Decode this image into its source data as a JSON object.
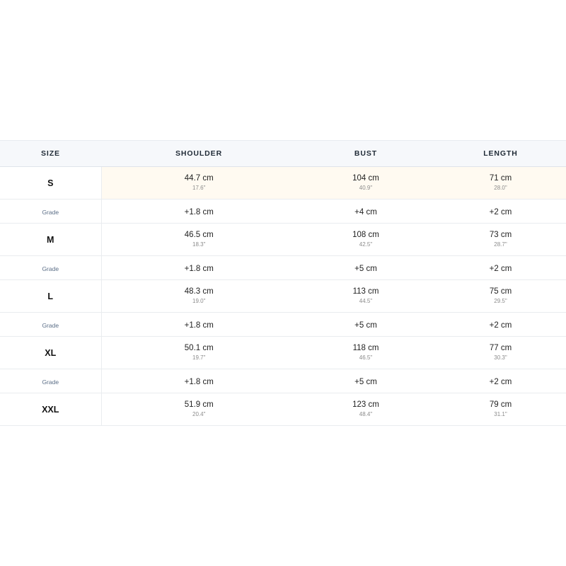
{
  "header": {
    "size": "SIZE",
    "shoulder": "SHOULDER",
    "bust": "BUST",
    "length": "LENGTH"
  },
  "grade_label": "Grade",
  "sizes": [
    {
      "name": "S",
      "shoulder": {
        "cm": "44.7 cm",
        "in": "17.6\""
      },
      "bust": {
        "cm": "104 cm",
        "in": "40.9\""
      },
      "length": {
        "cm": "71 cm",
        "in": "28.0\""
      }
    },
    {
      "name": "M",
      "shoulder": {
        "cm": "46.5 cm",
        "in": "18.3\""
      },
      "bust": {
        "cm": "108 cm",
        "in": "42.5\""
      },
      "length": {
        "cm": "73 cm",
        "in": "28.7\""
      }
    },
    {
      "name": "L",
      "shoulder": {
        "cm": "48.3 cm",
        "in": "19.0\""
      },
      "bust": {
        "cm": "113 cm",
        "in": "44.5\""
      },
      "length": {
        "cm": "75 cm",
        "in": "29.5\""
      }
    },
    {
      "name": "XL",
      "shoulder": {
        "cm": "50.1 cm",
        "in": "19.7\""
      },
      "bust": {
        "cm": "118 cm",
        "in": "46.5\""
      },
      "length": {
        "cm": "77 cm",
        "in": "30.3\""
      }
    },
    {
      "name": "XXL",
      "shoulder": {
        "cm": "51.9 cm",
        "in": "20.4\""
      },
      "bust": {
        "cm": "123 cm",
        "in": "48.4\""
      },
      "length": {
        "cm": "79 cm",
        "in": "31.1\""
      }
    }
  ],
  "grades": [
    {
      "shoulder": "+1.8 cm",
      "bust": "+4 cm",
      "length": "+2 cm"
    },
    {
      "shoulder": "+1.8 cm",
      "bust": "+5 cm",
      "length": "+2 cm"
    },
    {
      "shoulder": "+1.8 cm",
      "bust": "+5 cm",
      "length": "+2 cm"
    },
    {
      "shoulder": "+1.8 cm",
      "bust": "+5 cm",
      "length": "+2 cm"
    }
  ],
  "colors": {
    "header_bg": "#f6f8fb",
    "highlight_bg": "#fffaf1",
    "grade_label": "#5b6e87"
  }
}
